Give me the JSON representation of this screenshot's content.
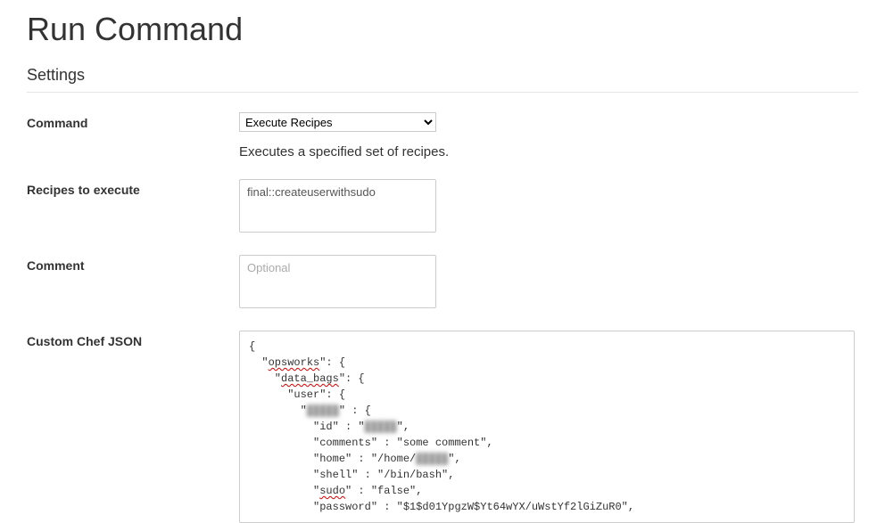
{
  "page_title": "Run Command",
  "section_title": "Settings",
  "fields": {
    "command": {
      "label": "Command",
      "selected": "Execute Recipes",
      "help": "Executes a specified set of recipes."
    },
    "recipes": {
      "label": "Recipes to execute",
      "value": "final::createuserwithsudo"
    },
    "comment": {
      "label": "Comment",
      "value": "",
      "placeholder": "Optional"
    },
    "custom_json": {
      "label": "Custom Chef JSON",
      "value": "{\n  \"opsworks\": {\n    \"data_bags\": {\n      \"user\": {\n        \"▓▓▓▓▓\" : {\n          \"id\" : \"▓▓▓▓▓\",\n          \"comments\" : \"some comment\",\n          \"home\" : \"/home/▓▓▓▓▓\",\n          \"shell\" : \"/bin/bash\",\n          \"sudo\" : \"false\",\n          \"password\" : \"$1$d01YpgzW$Yt64wYX/uWstYf2lGiZuR0\","
    }
  }
}
